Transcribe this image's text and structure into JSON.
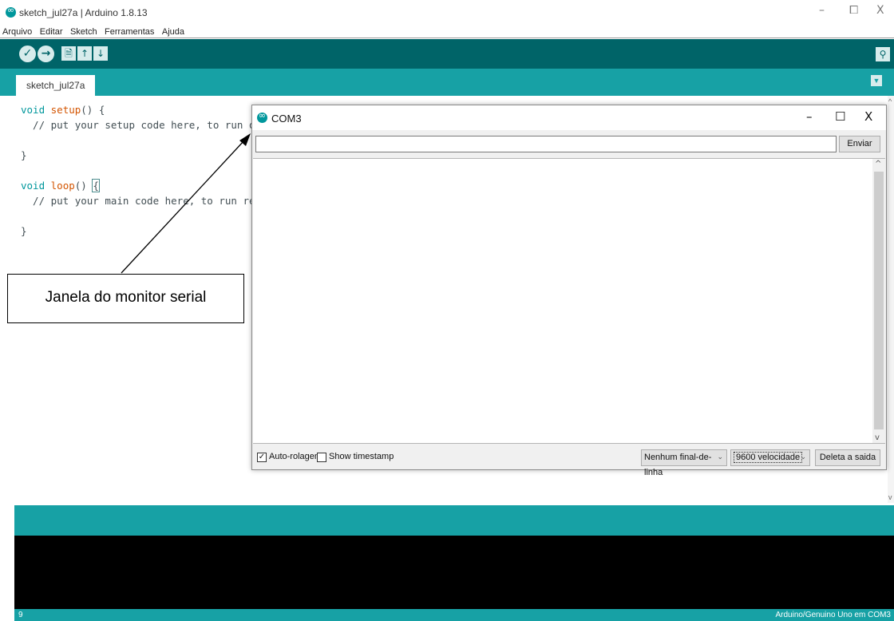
{
  "window": {
    "title": "sketch_jul27a | Arduino 1.8.13",
    "controls": {
      "minimize": "–",
      "maximize": "⧠",
      "close": "X"
    }
  },
  "menubar": {
    "items": [
      "Arquivo",
      "Editar",
      "Sketch",
      "Ferramentas",
      "Ajuda"
    ]
  },
  "toolbar": {
    "verify": "✓",
    "upload": "→",
    "new": "🗎",
    "open": "↑",
    "save": "↓",
    "serial_monitor": "⚲"
  },
  "tabs": {
    "active": "sketch_jul27a",
    "menu": "▼"
  },
  "code": {
    "line1_kw": "void",
    "line1_fn": "setup",
    "line1_rest": "() {",
    "line2": "  // put your setup code here, to run on",
    "line4": "}",
    "line6_kw": "void",
    "line6_fn": "loop",
    "line6_rest": "() ",
    "line6_brace": "{",
    "line7": "  // put your main code here, to run rep",
    "line9": "}"
  },
  "status": {
    "line_number": "9",
    "board": "Arduino/Genuino Uno em COM3"
  },
  "serial_monitor": {
    "title": "COM3",
    "controls": {
      "minimize": "–",
      "maximize": "☐",
      "close": "X"
    },
    "input_value": "",
    "send_label": "Enviar",
    "autoscroll_label": "Auto-rolagem",
    "autoscroll_checked": "✓",
    "timestamp_label": "Show timestamp",
    "timestamp_checked": "",
    "line_ending": "Nenhum final-de-linha",
    "baud_rate": "9600 velocidade",
    "clear_label": "Deleta a saida",
    "dropdown_arrow": "⌄"
  },
  "annotation": {
    "label": "Janela do monitor serial"
  }
}
